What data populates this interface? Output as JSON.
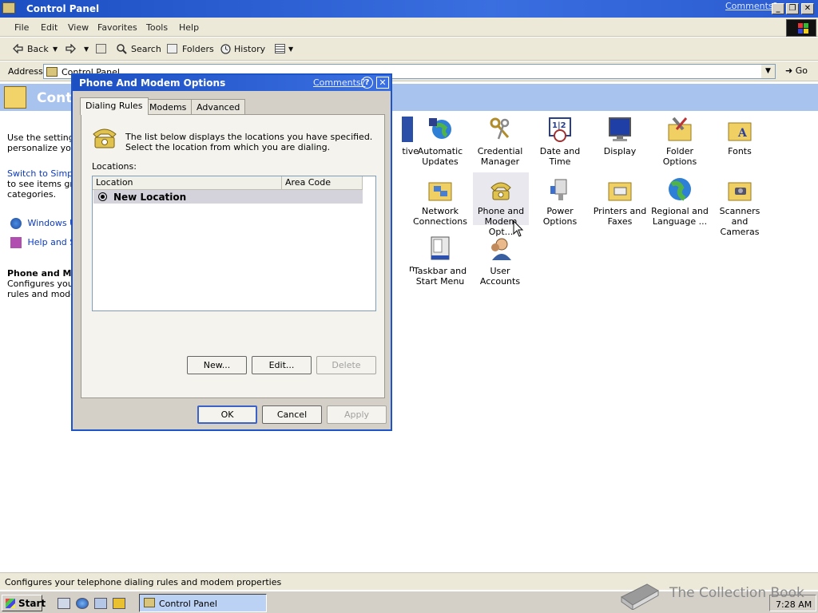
{
  "window": {
    "title": "Control Panel",
    "comments_link": "Comments?",
    "minimize": "_",
    "restore": "❐",
    "close": "✕"
  },
  "menu": [
    "File",
    "Edit",
    "View",
    "Favorites",
    "Tools",
    "Help"
  ],
  "toolbar": {
    "back": "Back",
    "search": "Search",
    "folders": "Folders",
    "history": "History"
  },
  "address": {
    "label": "Address",
    "value": "Control Panel",
    "go": "Go"
  },
  "band_title": "Contr",
  "left_pane": {
    "intro_l1": "Use the settings",
    "intro_l2": "personalize your",
    "switch_l1": "Switch to Simple",
    "switch_l2": "to see items grou",
    "switch_l3": "categories.",
    "link_windows_update": "Windows Up",
    "link_help": "Help and Su",
    "sel_title": "Phone and Mo",
    "sel_desc_l1": "Configures your",
    "sel_desc_l2": "rules and modem"
  },
  "icons": [
    {
      "l1": "tive",
      "l2": ""
    },
    {
      "l1": "Automatic",
      "l2": "Updates"
    },
    {
      "l1": "Credential",
      "l2": "Manager"
    },
    {
      "l1": "Date and Time",
      "l2": ""
    },
    {
      "l1": "Display",
      "l2": ""
    },
    {
      "l1": "Folder Options",
      "l2": ""
    },
    {
      "l1": "Fonts",
      "l2": ""
    },
    {
      "l1": "Network",
      "l2": "Connections"
    },
    {
      "l1": "Phone and",
      "l2": "Modem Opt..."
    },
    {
      "l1": "Power Options",
      "l2": ""
    },
    {
      "l1": "Printers and",
      "l2": "Faxes"
    },
    {
      "l1": "Regional and",
      "l2": "Language ..."
    },
    {
      "l1": "Scanners and",
      "l2": "Cameras"
    },
    {
      "l1": "Taskbar and",
      "l2": "Start Menu"
    },
    {
      "l1": "User Accounts",
      "l2": ""
    },
    {
      "l1": "n",
      "l2": ""
    }
  ],
  "status": "Configures your telephone dialing rules and modem properties",
  "taskbar": {
    "start": "Start",
    "task": "Control Panel",
    "clock": "7:28 AM"
  },
  "watermark": "The Collection Book",
  "dialog": {
    "title": "Phone And Modem Options",
    "comments": "Comments?",
    "help": "?",
    "close": "✕",
    "tabs": [
      "Dialing Rules",
      "Modems",
      "Advanced"
    ],
    "description": "The list below displays the locations you have specified. Select the location from which you are dialing.",
    "locations_label": "Locations:",
    "columns": [
      "Location",
      "Area Code"
    ],
    "rows": [
      {
        "location": "New Location",
        "area_code": ""
      }
    ],
    "buttons": {
      "new": "New...",
      "edit": "Edit...",
      "delete": "Delete"
    },
    "ok": "OK",
    "cancel": "Cancel",
    "apply": "Apply"
  }
}
